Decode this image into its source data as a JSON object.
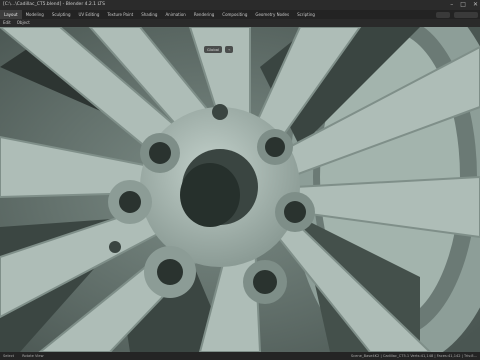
{
  "window": {
    "title": "[C:\\...\\Cadillac_CT5.blend] - Blender 4.2.1 LTS",
    "controls": [
      "–",
      "□",
      "✕"
    ]
  },
  "workspaces": [
    "Layout",
    "Modeling",
    "Sculpting",
    "UV Editing",
    "Texture Paint",
    "Shading",
    "Animation",
    "Rendering",
    "Compositing",
    "Geometry Nodes",
    "Scripting"
  ],
  "active_workspace": "Layout",
  "header_menu": [
    "Edit",
    "Object"
  ],
  "viewport": {
    "transform_orientation": "Global"
  },
  "statusbar": {
    "left_items": [
      "Select",
      "Rotate View"
    ],
    "right_text": "Scene_Base4K2 | Cadillac_CT5.1 Verts:41,148 | Faces:41,142 | Tris:8..."
  },
  "colors": {
    "rim_light": "#b7c6c0",
    "rim_mid": "#9aaba4",
    "rim_shadow": "#5c6a65",
    "hole_dark": "#26302c"
  }
}
